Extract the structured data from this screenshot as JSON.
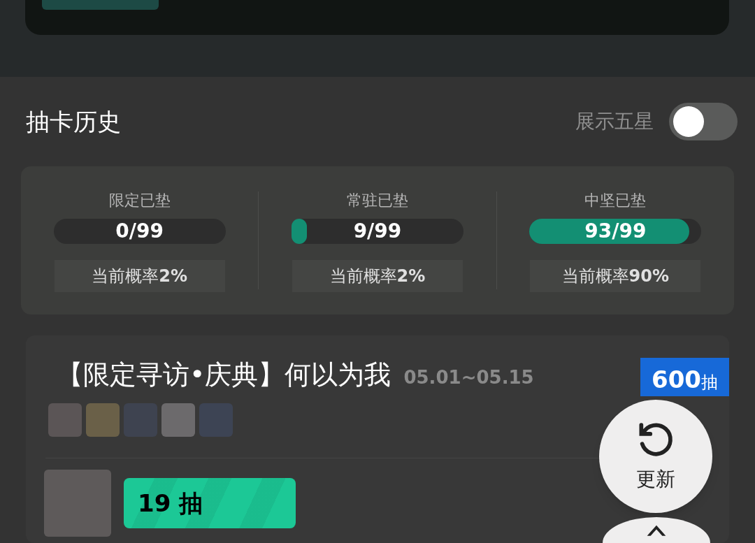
{
  "header": {
    "title": "抽卡历史",
    "toggle_label": "展示五星",
    "toggle_on": false
  },
  "pity": [
    {
      "label": "限定已垫",
      "count": "0/99",
      "level": 0,
      "rate": "当前概率**2%**"
    },
    {
      "label": "常驻已垫",
      "count": "9/99",
      "level": 0.09,
      "rate": "当前概率**2%**"
    },
    {
      "label": "中坚已垫",
      "count": "93/99",
      "level": 0.93,
      "rate": "当前概率**90%**"
    }
  ],
  "pool": {
    "title": "【限定寻访•庆典】何以为我",
    "dates": "05.01~05.15",
    "total": "600",
    "total_unit": "抽",
    "pulls": [
      {
        "count": "19 抽"
      }
    ]
  },
  "refresh_button": "更新"
}
